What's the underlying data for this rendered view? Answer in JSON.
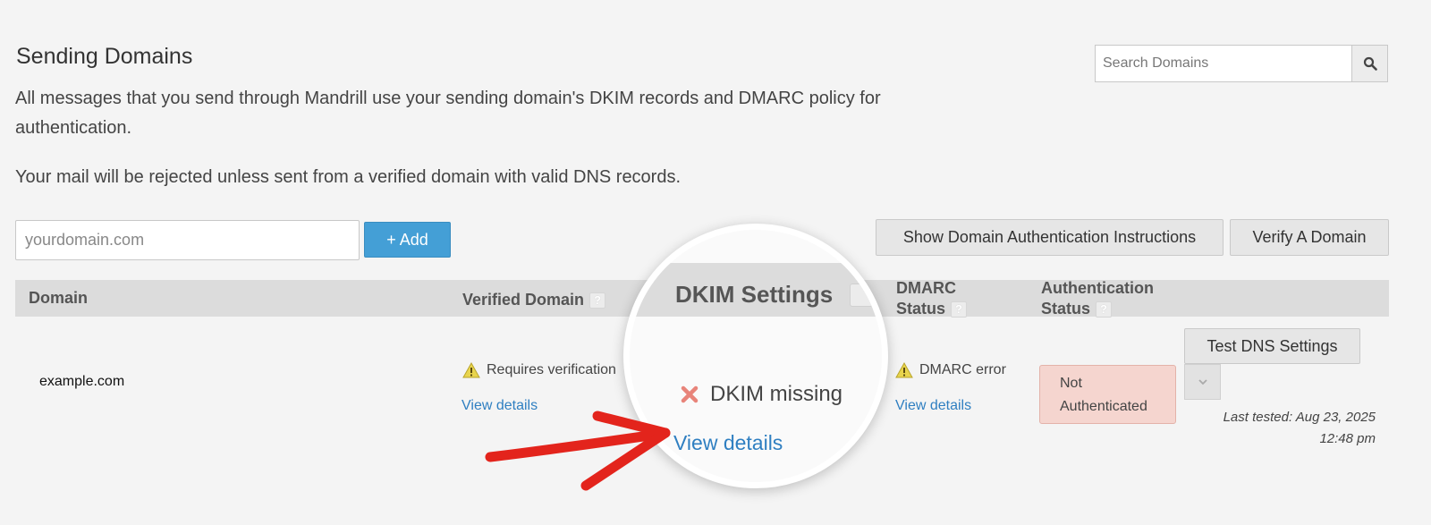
{
  "header": {
    "title": "Sending Domains",
    "intro": "All messages that you send through Mandrill use your sending domain's DKIM records and DMARC policy for authentication.",
    "warning": "Your mail will be rejected unless sent from a verified domain with valid DNS records."
  },
  "search": {
    "placeholder": "Search Domains",
    "icon": "search-icon"
  },
  "add_domain": {
    "placeholder": "yourdomain.com",
    "button_label": "+ Add"
  },
  "actions": {
    "instructions_label": "Show Domain Authentication Instructions",
    "verify_label": "Verify A Domain"
  },
  "table": {
    "columns": {
      "domain": "Domain",
      "verified": "Verified Domain",
      "dkim": "DKIM Settings",
      "dmarc_line1": "DMARC",
      "dmarc_line2": "Status",
      "auth_line1": "Authentication",
      "auth_line2": "Status",
      "help": "?"
    },
    "rows": [
      {
        "domain": "example.com",
        "verified_status": "Requires verification",
        "verified_link": "View details",
        "dkim_status": "DKIM missing",
        "dkim_link": "View details",
        "dmarc_status": "DMARC error",
        "dmarc_link": "View details",
        "auth_status_line1": "Not",
        "auth_status_line2": "Authenticated",
        "test_button": "Test DNS Settings",
        "last_tested_line1": "Last tested: Aug 23, 2025",
        "last_tested_line2": "12:48 pm"
      }
    ]
  },
  "colors": {
    "accent": "#449fd6",
    "link": "#2f7fc1",
    "warning": "#e0c840",
    "error": "#e8847a",
    "not_authenticated_bg": "#f5d5cf",
    "arrow": "#e3241c"
  }
}
